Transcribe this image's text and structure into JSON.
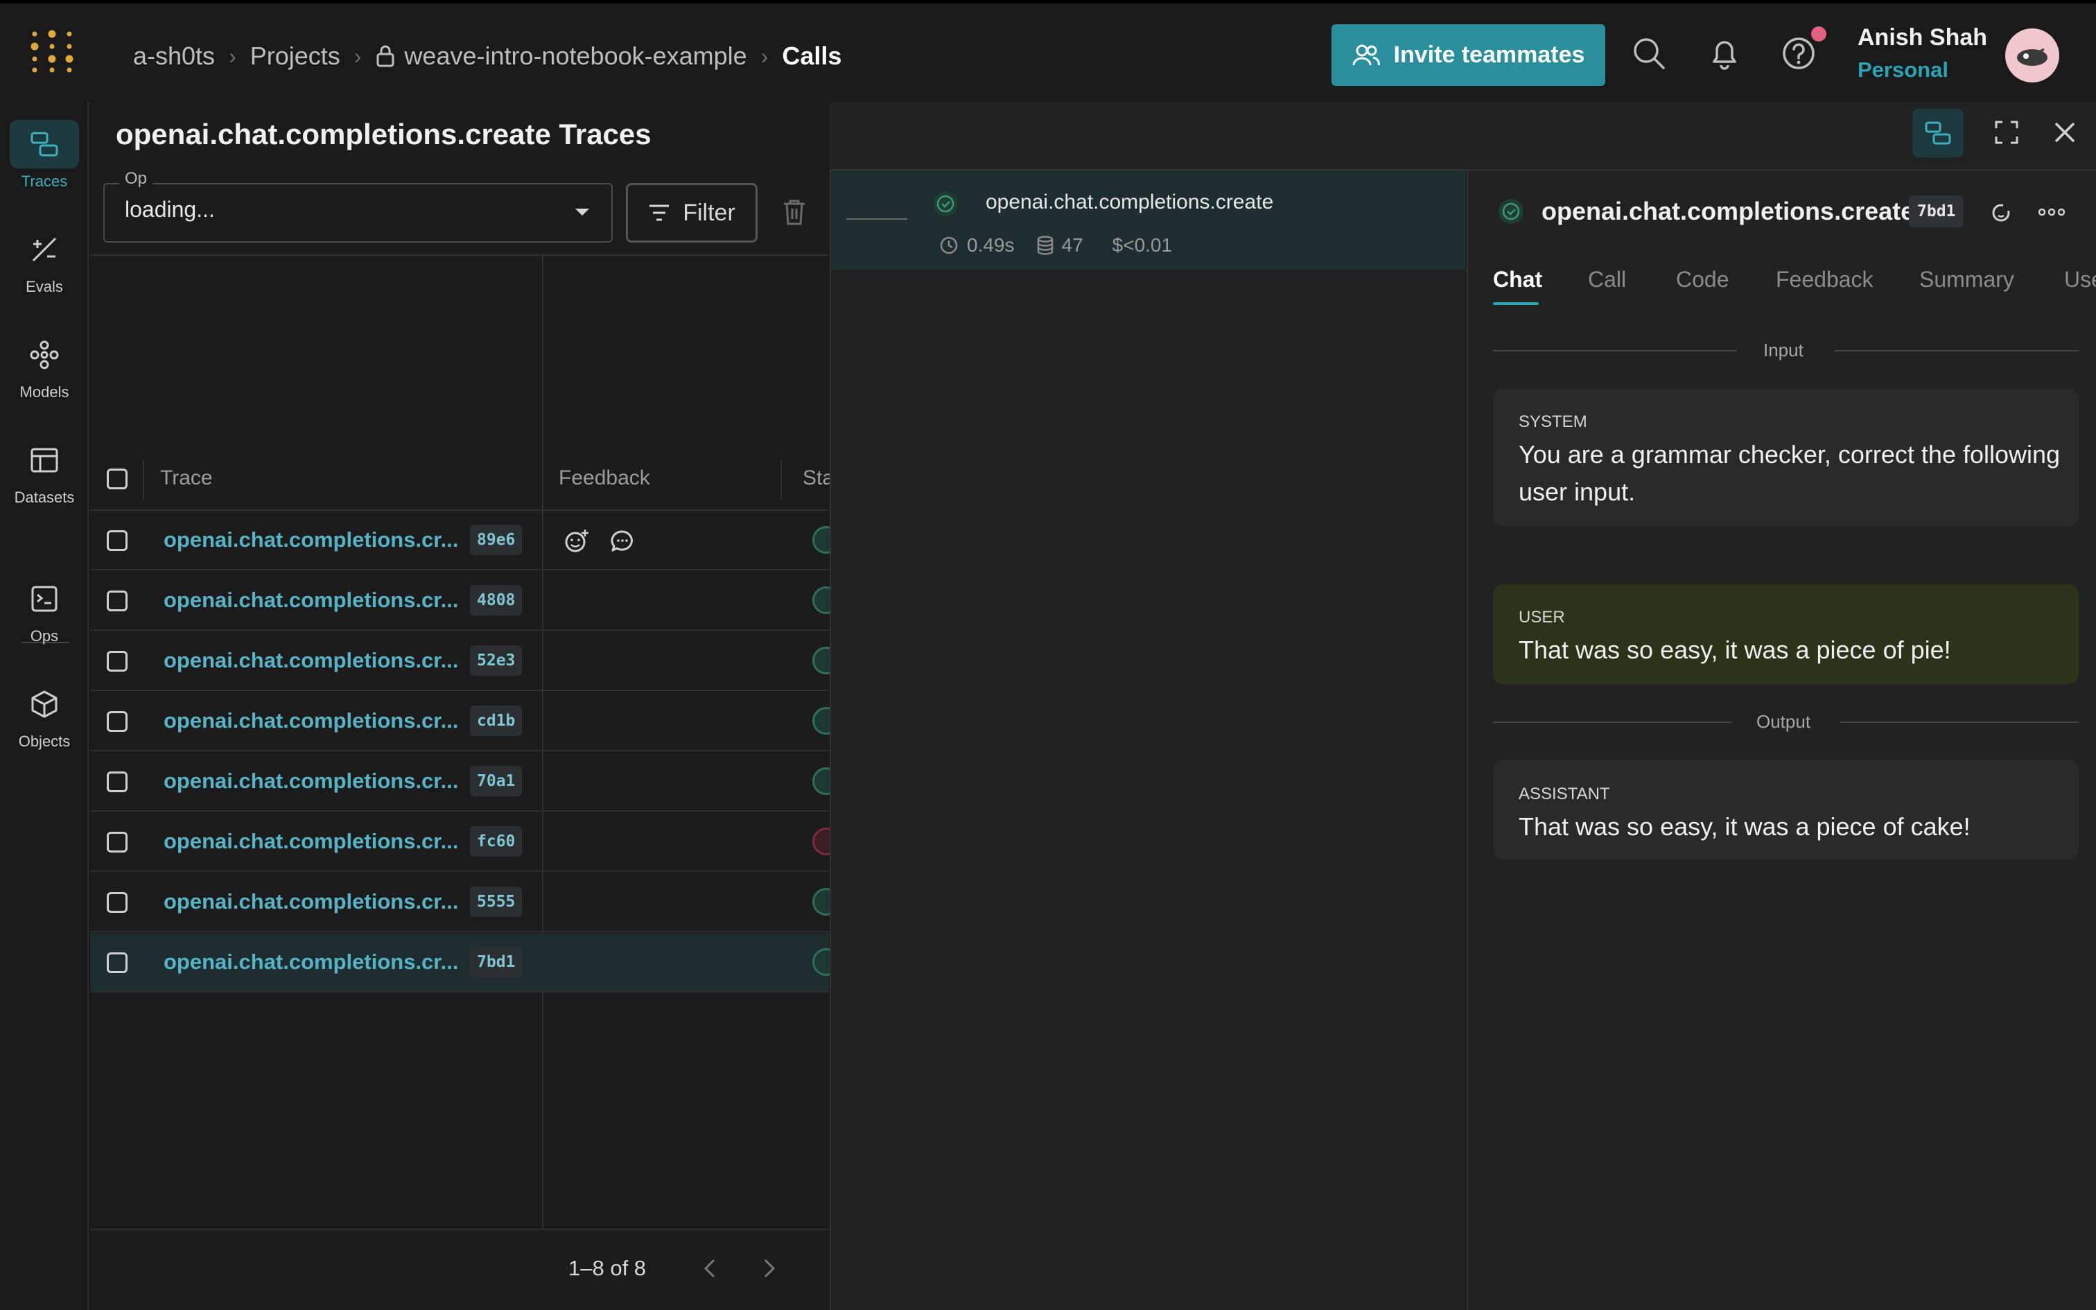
{
  "breadcrumbs": [
    {
      "label": "a-sh0ts"
    },
    {
      "label": "Projects"
    },
    {
      "label": "weave-intro-notebook-example"
    },
    {
      "label": "Calls"
    }
  ],
  "header": {
    "invite_label": "Invite teammates",
    "user_name": "Anish Shah",
    "user_entity": "Personal"
  },
  "nav": {
    "items": [
      {
        "label": "Traces",
        "icon": "traces-icon"
      },
      {
        "label": "Evals",
        "icon": "evals-icon"
      },
      {
        "label": "Models",
        "icon": "models-icon"
      },
      {
        "label": "Datasets",
        "icon": "datasets-icon"
      },
      {
        "label": "Ops",
        "icon": "ops-icon"
      },
      {
        "label": "Objects",
        "icon": "objects-icon"
      }
    ]
  },
  "traces": {
    "title": "openai.chat.completions.create Traces",
    "op_label": "Op",
    "op_value": "loading...",
    "filter_label": "Filter",
    "columns": {
      "trace": "Trace",
      "feedback": "Feedback",
      "status": "Sta"
    },
    "rows": [
      {
        "name": "openai.chat.completions.cr...",
        "id": "89e6",
        "status": "success"
      },
      {
        "name": "openai.chat.completions.cr...",
        "id": "4808",
        "status": "success"
      },
      {
        "name": "openai.chat.completions.cr...",
        "id": "52e3",
        "status": "success"
      },
      {
        "name": "openai.chat.completions.cr...",
        "id": "cd1b",
        "status": "success"
      },
      {
        "name": "openai.chat.completions.cr...",
        "id": "70a1",
        "status": "success"
      },
      {
        "name": "openai.chat.completions.cr...",
        "id": "fc60",
        "status": "error"
      },
      {
        "name": "openai.chat.completions.cr...",
        "id": "5555",
        "status": "success"
      },
      {
        "name": "openai.chat.completions.cr...",
        "id": "7bd1",
        "status": "success"
      }
    ],
    "pager": "1–8 of 8"
  },
  "trace_tree": {
    "name": "openai.chat.completions.create",
    "latency": "0.49s",
    "tokens": "47",
    "cost": "$<0.01"
  },
  "detail": {
    "name": "openai.chat.completions.create",
    "id": "7bd1",
    "tabs": [
      "Chat",
      "Call",
      "Code",
      "Feedback",
      "Summary",
      "Use"
    ],
    "active_tab": "Chat",
    "input_label": "Input",
    "output_label": "Output",
    "messages": {
      "system": {
        "role": "SYSTEM",
        "line1": "You are a grammar checker, correct the following",
        "line2": "user input."
      },
      "user": {
        "role": "USER",
        "text": "That was so easy, it was a piece of pie!"
      },
      "assistant": {
        "role": "ASSISTANT",
        "text": "That was so easy, it was a piece of cake!"
      }
    }
  },
  "colors": {
    "accent": "#2aa5b4",
    "invite_bg": "#2b8e9c",
    "success": "#3a9a74",
    "error": "#c0485e",
    "user_message_bg": "#2b3319"
  }
}
